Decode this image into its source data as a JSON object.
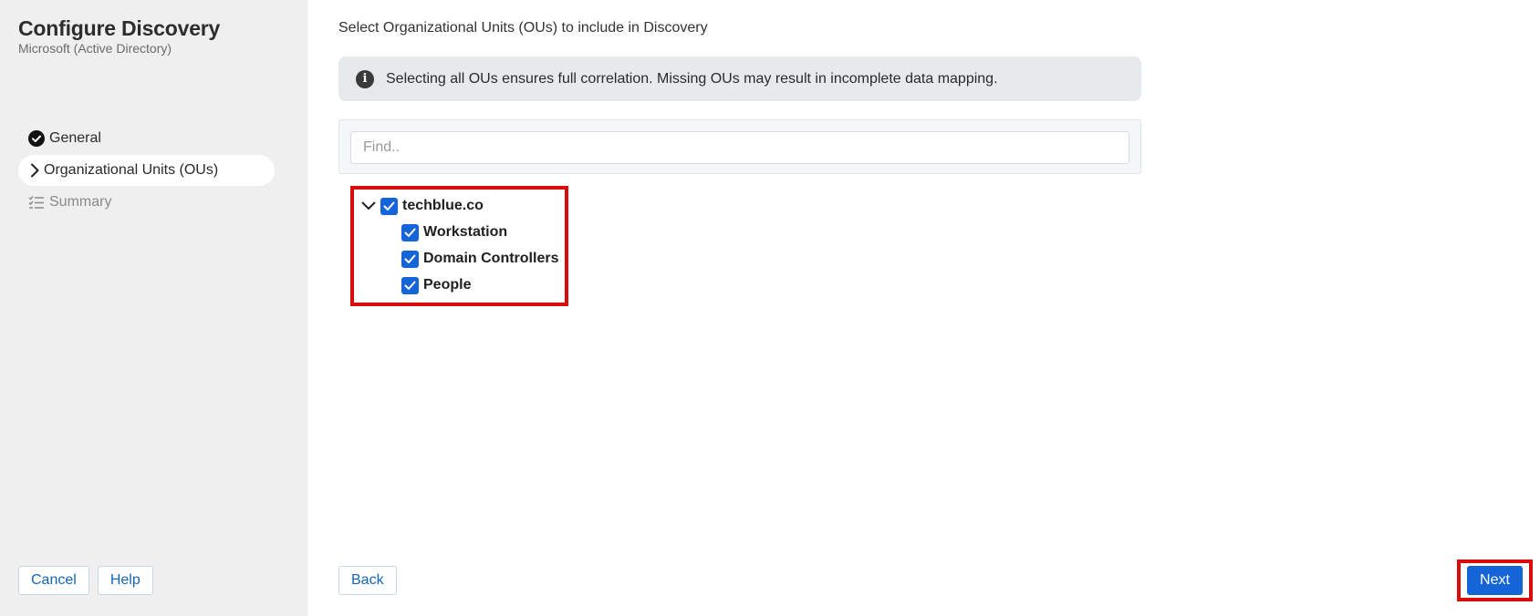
{
  "sidebar": {
    "title": "Configure Discovery",
    "subtitle": "Microsoft (Active Directory)",
    "steps": [
      {
        "label": "General",
        "icon": "check-circle-icon",
        "state": "completed"
      },
      {
        "label": "Organizational Units (OUs)",
        "icon": "chevron-right-icon",
        "state": "active"
      },
      {
        "label": "Summary",
        "icon": "checklist-icon",
        "state": "upcoming"
      }
    ],
    "cancel_label": "Cancel",
    "help_label": "Help"
  },
  "main": {
    "heading": "Select Organizational Units (OUs) to include in Discovery",
    "info_message": "Selecting all OUs ensures full correlation. Missing OUs may result in incomplete data mapping.",
    "find_placeholder": "Find..",
    "find_value": "",
    "tree": {
      "root": {
        "label": "techblue.co",
        "checked": true,
        "expanded": true
      },
      "children": [
        {
          "label": "Workstation",
          "checked": true
        },
        {
          "label": "Domain Controllers",
          "checked": true
        },
        {
          "label": "People",
          "checked": true
        }
      ]
    },
    "back_label": "Back",
    "next_label": "Next"
  },
  "colors": {
    "accent": "#1565d8",
    "highlight_border": "#d90b0b",
    "sidebar_bg": "#efefef",
    "info_bg": "#e6eaed"
  }
}
